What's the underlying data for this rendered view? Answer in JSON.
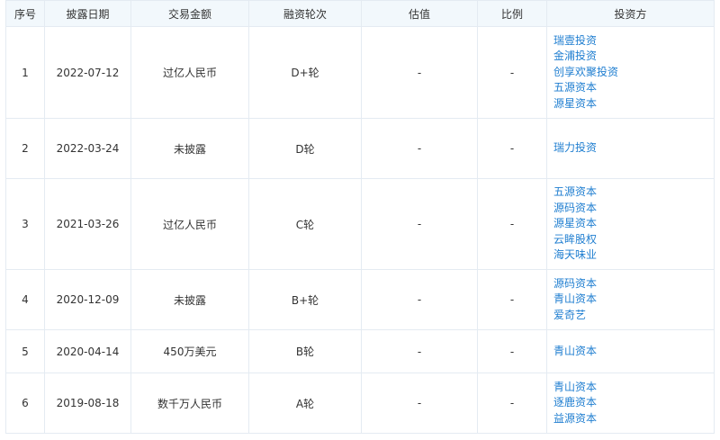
{
  "headers": [
    "序号",
    "披露日期",
    "交易金额",
    "融资轮次",
    "估值",
    "比例",
    "投资方"
  ],
  "rows": [
    {
      "index": "1",
      "date": "2022-07-12",
      "amount": "过亿人民币",
      "round": "D+轮",
      "valuation": "-",
      "ratio": "-",
      "investors": [
        "瑞壹投资",
        "金浦投资",
        "创享欢聚投资",
        "五源资本",
        "源星资本"
      ]
    },
    {
      "index": "2",
      "date": "2022-03-24",
      "amount": "未披露",
      "round": "D轮",
      "valuation": "-",
      "ratio": "-",
      "investors": [
        "瑞力投资"
      ]
    },
    {
      "index": "3",
      "date": "2021-03-26",
      "amount": "过亿人民币",
      "round": "C轮",
      "valuation": "-",
      "ratio": "-",
      "investors": [
        "五源资本",
        "源码资本",
        "源星资本",
        "云眸股权",
        "海天味业"
      ]
    },
    {
      "index": "4",
      "date": "2020-12-09",
      "amount": "未披露",
      "round": "B+轮",
      "valuation": "-",
      "ratio": "-",
      "investors": [
        "源码资本",
        "青山资本",
        "爱奇艺"
      ]
    },
    {
      "index": "5",
      "date": "2020-04-14",
      "amount": "450万美元",
      "round": "B轮",
      "valuation": "-",
      "ratio": "-",
      "investors": [
        "青山资本"
      ]
    },
    {
      "index": "6",
      "date": "2019-08-18",
      "amount": "数千万人民币",
      "round": "A轮",
      "valuation": "-",
      "ratio": "-",
      "investors": [
        "青山资本",
        "逐鹿资本",
        "益源资本"
      ]
    }
  ],
  "colors": {
    "header_bg": "#f2f8fc",
    "border": "#e4ebf2",
    "link": "#1f7ed0",
    "text": "#333333"
  }
}
